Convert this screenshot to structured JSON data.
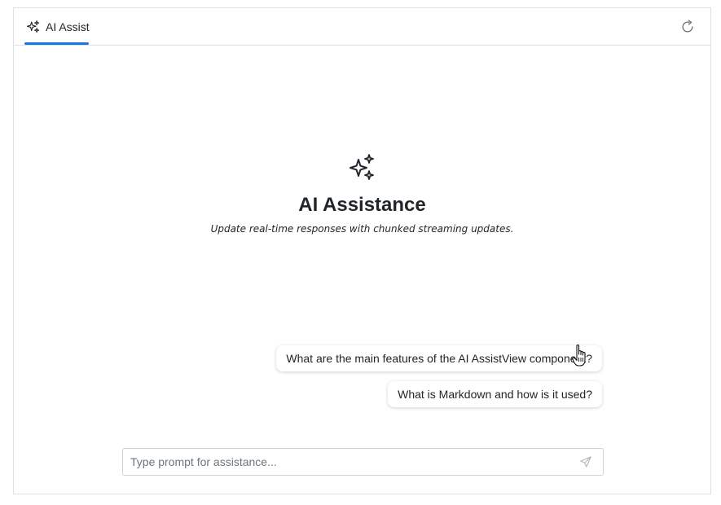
{
  "header": {
    "tab_label": "AI Assist",
    "tab_icon": "sparkle-icon",
    "refresh_icon": "refresh-icon"
  },
  "banner": {
    "icon": "sparkle-icon",
    "title": "AI Assistance",
    "subtitle": "Update real-time responses with chunked streaming updates."
  },
  "suggestions": [
    "What are the main features of the AI AssistView component?",
    "What is Markdown and how is it used?"
  ],
  "prompt": {
    "placeholder": "Type prompt for assistance...",
    "value": "",
    "send_icon": "send-icon"
  },
  "colors": {
    "accent": "#1a73e8",
    "border": "#dee2e6",
    "text": "#212529",
    "placeholder": "#6c757d"
  }
}
